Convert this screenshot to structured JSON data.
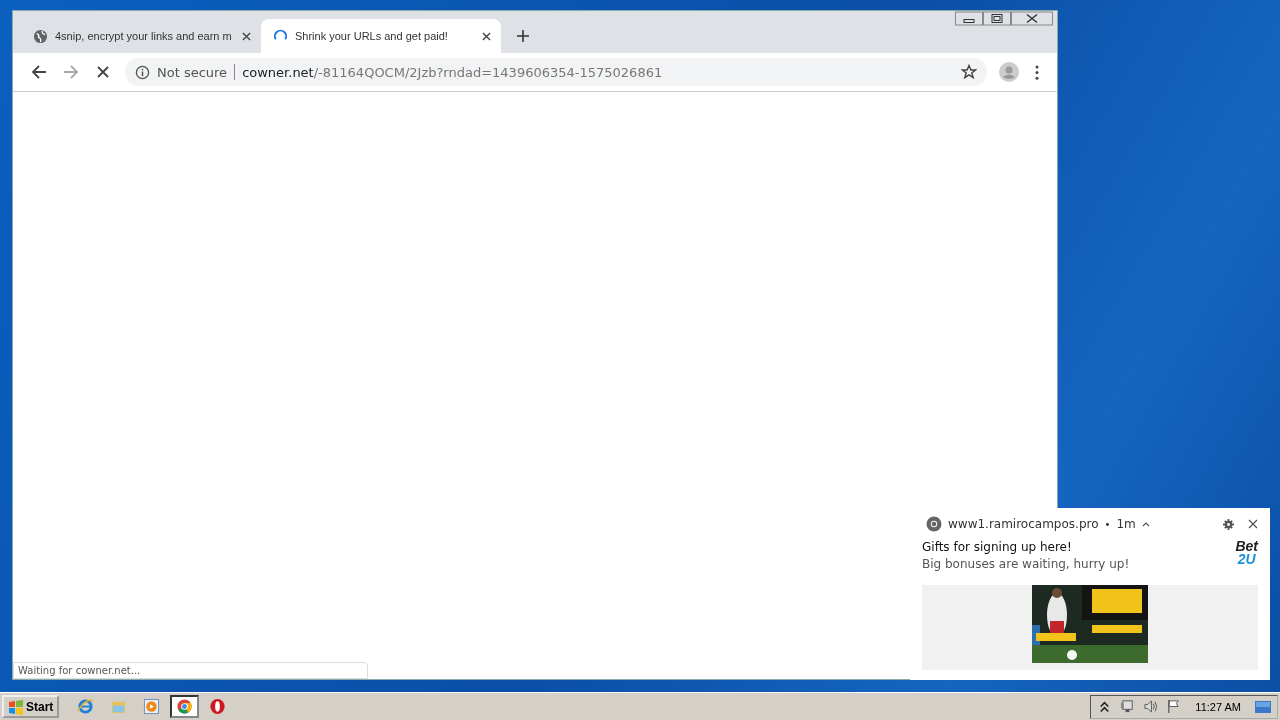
{
  "browser": {
    "tabs": [
      {
        "title": "4snip, encrypt your links and earn m",
        "selected": false,
        "loading": false
      },
      {
        "title": "Shrink your URLs and get paid!",
        "selected": true,
        "loading": true
      }
    ],
    "security": "Not secure",
    "url_host": "cowner.net",
    "url_path": "/-81164QOCM/2Jzb?rndad=1439606354-1575026861",
    "status": "Waiting for cowner.net..."
  },
  "notification": {
    "site": "www1.ramirocampos.pro",
    "separator": "•",
    "age": "1m",
    "title": "Gifts for signing up here!",
    "body": "Big bonuses are waiting, hurry up!",
    "logo": [
      "Bet",
      "2U"
    ]
  },
  "taskbar": {
    "start": "Start",
    "apps": [
      {
        "kind": "ie",
        "selected": false
      },
      {
        "kind": "explorer",
        "selected": false
      },
      {
        "kind": "media",
        "selected": false
      },
      {
        "kind": "chrome",
        "selected": true
      },
      {
        "kind": "opera",
        "selected": false
      }
    ],
    "clock": "11:27 AM"
  }
}
